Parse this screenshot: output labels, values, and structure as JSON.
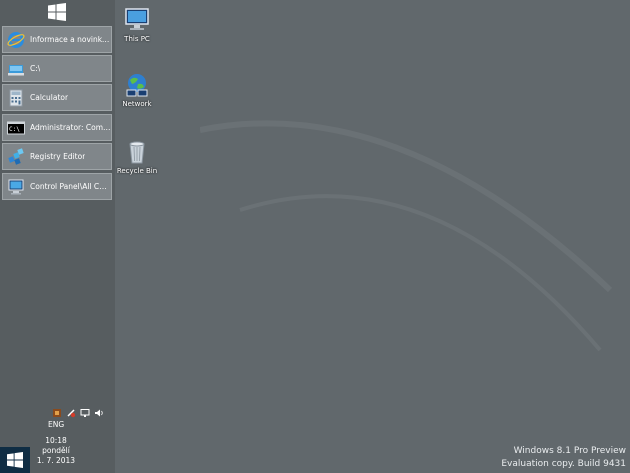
{
  "taskbar": {
    "items": [
      {
        "label": "Informace a novinky o...",
        "icon": "internet-explorer-icon"
      },
      {
        "label": "C:\\",
        "icon": "folder-drive-icon"
      },
      {
        "label": "Calculator",
        "icon": "calculator-icon"
      },
      {
        "label": "Administrator: Comm...",
        "icon": "command-prompt-icon"
      },
      {
        "label": "Registry Editor",
        "icon": "registry-editor-icon"
      },
      {
        "label": "Control Panel\\All Cont...",
        "icon": "control-panel-icon"
      }
    ],
    "language": "ENG",
    "clock": {
      "time": "10:18",
      "day": "pondělí",
      "date": "1. 7. 2013"
    }
  },
  "desktop": {
    "icons": [
      {
        "label": "This PC",
        "icon": "this-pc-icon"
      },
      {
        "label": "Network",
        "icon": "network-icon"
      },
      {
        "label": "Recycle Bin",
        "icon": "recycle-bin-icon"
      }
    ]
  },
  "watermark": {
    "line1": "Windows 8.1 Pro Preview",
    "line2": "Evaluation copy. Build 9431"
  },
  "colors": {
    "desktop": "#61686c",
    "taskbar": "#575d60",
    "task_item": "#80868a",
    "start_button": "#0f2d44"
  }
}
